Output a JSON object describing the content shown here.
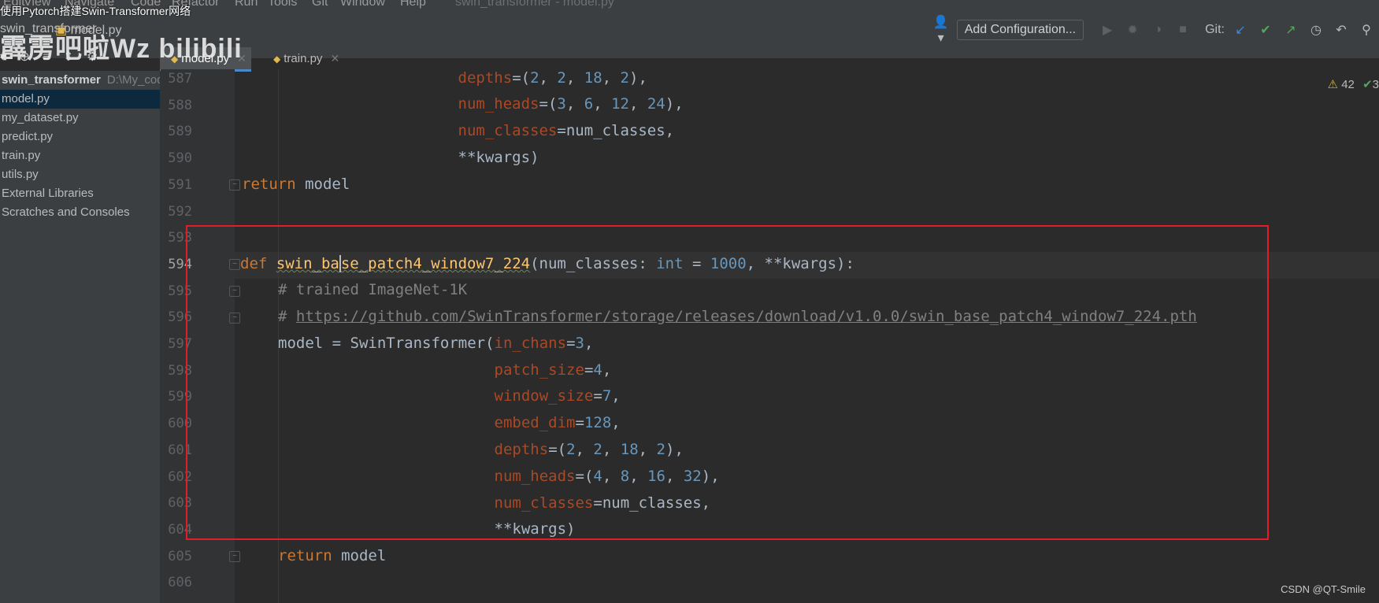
{
  "menu": {
    "items": [
      "Edit",
      "View",
      "Navigate",
      "Code",
      "Refactor",
      "Run",
      "Tools",
      "Git",
      "Window",
      "Help",
      "swin_transformer - model.py"
    ]
  },
  "video_title": "使用Pytorch搭建Swin-Transformer网络",
  "watermark": "霹雳吧啦Wz bilibili",
  "breadcrumb": {
    "project": "swin_transformer",
    "file": "model.py"
  },
  "toolbar": {
    "add_config_label": "Add Configuration...",
    "git_label": "Git:",
    "icons": [
      "user-icon",
      "run-icon",
      "debug-icon",
      "coverage-icon",
      "stop-icon",
      "git-update-icon",
      "git-commit-icon",
      "git-push-icon",
      "history-icon",
      "rollback-icon",
      "search-icon"
    ]
  },
  "tool_icons": [
    "project-view-icon",
    "add-icon",
    "collapse-icon",
    "expand-icon",
    "settings-icon"
  ],
  "tabs": [
    {
      "label": "model.py",
      "active": true
    },
    {
      "label": "train.py",
      "active": false
    }
  ],
  "project_tree": {
    "root_label": "swin_transformer",
    "root_path": "D:\\My_code",
    "items": [
      {
        "label": "model.py",
        "selected": true
      },
      {
        "label": "my_dataset.py",
        "selected": false
      },
      {
        "label": "predict.py",
        "selected": false
      },
      {
        "label": "train.py",
        "selected": false
      },
      {
        "label": "utils.py",
        "selected": false
      },
      {
        "label": "External Libraries",
        "selected": false
      },
      {
        "label": "Scratches and Consoles",
        "selected": false
      }
    ]
  },
  "editor": {
    "current_line": 594,
    "line_numbers": [
      "587",
      "588",
      "589",
      "590",
      "591",
      "592",
      "593",
      "594",
      "595",
      "596",
      "597",
      "598",
      "599",
      "600",
      "601",
      "602",
      "603",
      "604",
      "605",
      "606"
    ],
    "lines": [
      {
        "t": "depths=(2, 2, 18, 2),"
      },
      {
        "t": "num_heads=(3, 6, 12, 24),"
      },
      {
        "t": "num_classes=num_classes,"
      },
      {
        "t": "**kwargs)"
      },
      {
        "t": "return model"
      },
      {
        "t": ""
      },
      {
        "t": ""
      },
      {
        "t": "def swin_base_patch4_window7_224(num_classes: int = 1000, **kwargs):"
      },
      {
        "t": "# trained ImageNet-1K"
      },
      {
        "t": "# https://github.com/SwinTransformer/storage/releases/download/v1.0.0/swin_base_patch4_window7_224.pth"
      },
      {
        "t": "model = SwinTransformer(in_chans=3,"
      },
      {
        "t": "patch_size=4,"
      },
      {
        "t": "window_size=7,"
      },
      {
        "t": "embed_dim=128,"
      },
      {
        "t": "depths=(2, 2, 18, 2),"
      },
      {
        "t": "num_heads=(4, 8, 16, 32),"
      },
      {
        "t": "num_classes=num_classes,"
      },
      {
        "t": "**kwargs)"
      },
      {
        "t": "return model"
      },
      {
        "t": ""
      }
    ]
  },
  "inspections": {
    "warnings": "42",
    "ok": "3"
  },
  "credit": "CSDN @QT-Smile",
  "colors": {
    "keyword": "#cc7832",
    "function": "#ffc66d",
    "number": "#6897bb",
    "param": "#aa4926",
    "comment": "#808080",
    "highlight_box": "#e11d2a"
  }
}
